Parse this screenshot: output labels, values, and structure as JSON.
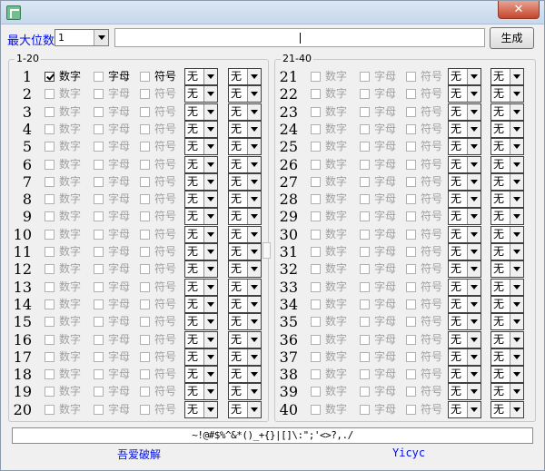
{
  "window": {
    "title": "",
    "close_glyph": "✕"
  },
  "toolbar": {
    "max_digits_label": "最大位数",
    "max_digits_value": "1",
    "output_value": "",
    "generate_label": "生成"
  },
  "groups": [
    {
      "title": "1-20",
      "start": 1,
      "count": 20
    },
    {
      "title": "21-40",
      "start": 21,
      "count": 20
    }
  ],
  "option_labels": {
    "digits": "数字",
    "letters": "字母",
    "symbols": "符号"
  },
  "select_value": "无",
  "checked": {
    "row": 1,
    "option": "digits"
  },
  "special_chars": "~!@#$%^&*()_+{}|[]\\:\";'<>?,./",
  "footer": {
    "left_link": "吾爱破解",
    "right_link": "Yicyc"
  }
}
